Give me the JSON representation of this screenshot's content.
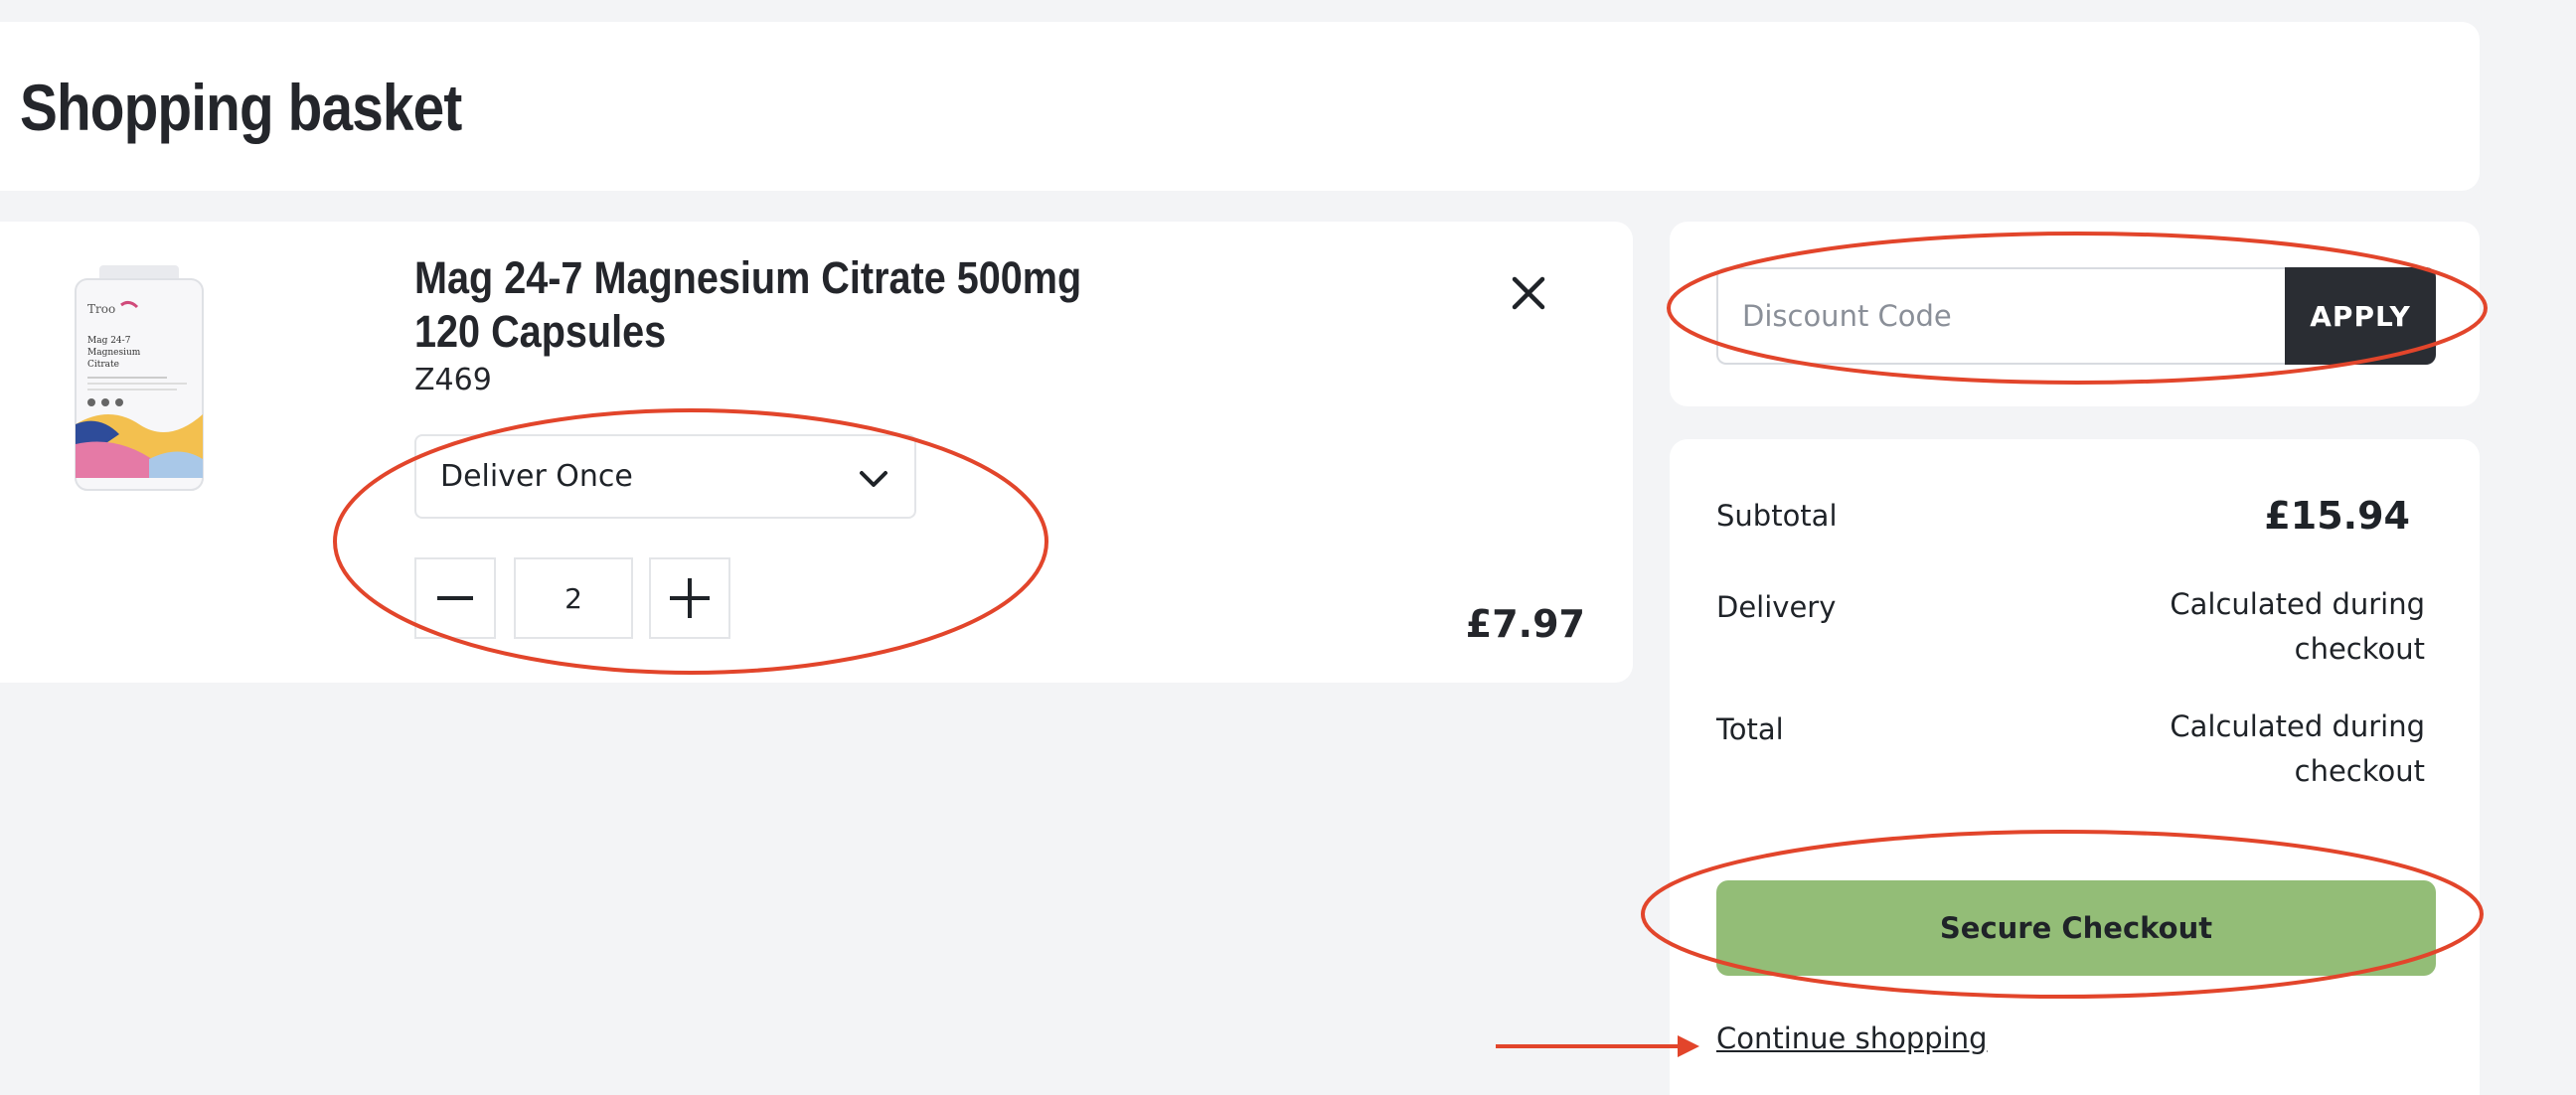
{
  "header": {
    "title": "Shopping basket"
  },
  "basket": {
    "items": [
      {
        "name": "Mag 24-7 Magnesium Citrate 500mg 120 Capsules",
        "sku": "Z469",
        "delivery_option": "Deliver Once",
        "quantity": "2",
        "price": "£7.97",
        "image_text": {
          "brand": "Troo",
          "product": "Mag 24-7 Magnesium Citrate"
        }
      }
    ]
  },
  "discount": {
    "placeholder": "Discount Code",
    "apply_label": "APPLY"
  },
  "summary": {
    "subtotal_label": "Subtotal",
    "subtotal_value": "£15.94",
    "delivery_label": "Delivery",
    "delivery_value": "Calculated during checkout",
    "total_label": "Total",
    "total_value": "Calculated during checkout",
    "checkout_label": "Secure Checkout",
    "continue_label": "Continue shopping"
  },
  "icons": {
    "remove": "close-icon",
    "select": "chevron-down-icon",
    "decrease": "minus-icon",
    "increase": "plus-icon"
  },
  "colors": {
    "background": "#f3f4f6",
    "apply_button": "#2a2d33",
    "checkout_button": "#93bd77",
    "annotation": "#e2452b"
  }
}
